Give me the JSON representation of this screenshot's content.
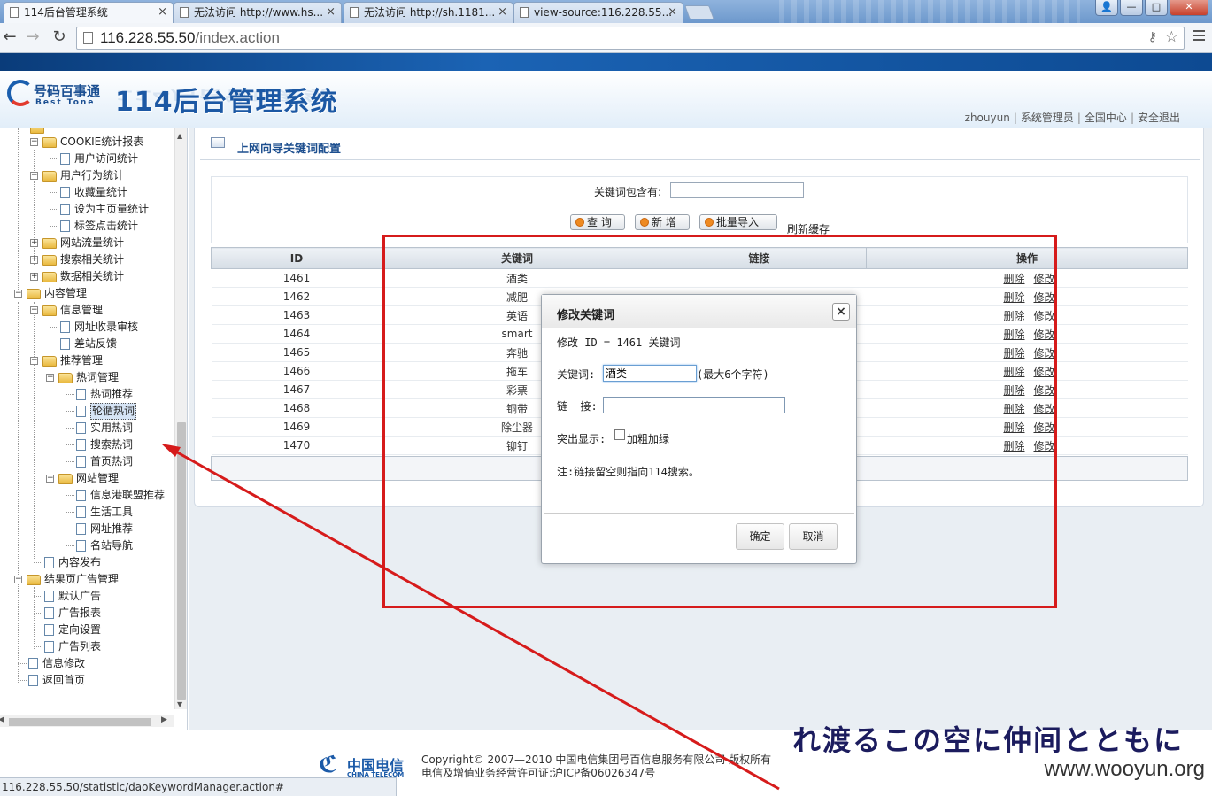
{
  "browser": {
    "tabs": [
      {
        "label": "114后台管理系统",
        "close": "×"
      },
      {
        "label": "无法访问 http://www.hs...",
        "close": "×"
      },
      {
        "label": "无法访问 http://sh.1181...",
        "close": "×"
      },
      {
        "label": "view-source:116.228.55...",
        "close": "×"
      }
    ],
    "window_buttons": {
      "minimize": "—",
      "maximize": "□",
      "close": "✕",
      "user": "👤"
    },
    "nav": {
      "back": "←",
      "forward": "→",
      "reload": "↻"
    },
    "url_host": "116.228.55.50",
    "url_path": "/index.action",
    "status_url": "116.228.55.50/statistic/daoKeywordManager.action#"
  },
  "header": {
    "logo_cn": "号码百事通",
    "logo_en": "Best Tone",
    "title": "114后台管理系统",
    "user_links": [
      "zhouyun",
      "系统管理员",
      "全国中心",
      "安全退出"
    ]
  },
  "sidebar": {
    "items": [
      {
        "label": "COOKIE统计报表",
        "type": "folder"
      },
      {
        "label": "用户访问统计",
        "type": "doc"
      },
      {
        "label": "用户行为统计",
        "type": "folder"
      },
      {
        "label": "收藏量统计",
        "type": "doc"
      },
      {
        "label": "设为主页量统计",
        "type": "doc"
      },
      {
        "label": "标签点击统计",
        "type": "doc"
      },
      {
        "label": "网站流量统计",
        "type": "folder"
      },
      {
        "label": "搜索相关统计",
        "type": "folder"
      },
      {
        "label": "数据相关统计",
        "type": "folder"
      },
      {
        "label": "内容管理",
        "type": "folder"
      },
      {
        "label": "信息管理",
        "type": "folder"
      },
      {
        "label": "网址收录审核",
        "type": "doc"
      },
      {
        "label": "差站反馈",
        "type": "doc"
      },
      {
        "label": "推荐管理",
        "type": "folder"
      },
      {
        "label": "热词管理",
        "type": "folder"
      },
      {
        "label": "热词推荐",
        "type": "doc"
      },
      {
        "label": "轮循热词",
        "type": "doc"
      },
      {
        "label": "实用热词",
        "type": "doc"
      },
      {
        "label": "搜索热词",
        "type": "doc"
      },
      {
        "label": "首页热词",
        "type": "doc"
      },
      {
        "label": "网站管理",
        "type": "folder"
      },
      {
        "label": "信息港联盟推荐",
        "type": "doc"
      },
      {
        "label": "生活工具",
        "type": "doc"
      },
      {
        "label": "网址推荐",
        "type": "doc"
      },
      {
        "label": "名站导航",
        "type": "doc"
      },
      {
        "label": "内容发布",
        "type": "doc"
      },
      {
        "label": "结果页广告管理",
        "type": "folder"
      },
      {
        "label": "默认广告",
        "type": "doc"
      },
      {
        "label": "广告报表",
        "type": "doc"
      },
      {
        "label": "定向设置",
        "type": "doc"
      },
      {
        "label": "广告列表",
        "type": "doc"
      },
      {
        "label": "信息修改",
        "type": "doc"
      },
      {
        "label": "返回首页",
        "type": "doc"
      }
    ]
  },
  "page": {
    "title": "上网向导关键词配置",
    "search_label": "关键词包含有:",
    "search_value": "",
    "buttons": {
      "query": "查 询",
      "add": "新 增",
      "import": "批量导入"
    },
    "refresh_link": "刷新缓存"
  },
  "table": {
    "columns": [
      "ID",
      "关键词",
      "链接",
      "操作"
    ],
    "rows": [
      {
        "id": "1461",
        "keyword": "酒类",
        "link": ""
      },
      {
        "id": "1462",
        "keyword": "减肥",
        "link": ""
      },
      {
        "id": "1463",
        "keyword": "英语",
        "link": ""
      },
      {
        "id": "1464",
        "keyword": "smart",
        "link": ""
      },
      {
        "id": "1465",
        "keyword": "奔驰",
        "link": ""
      },
      {
        "id": "1466",
        "keyword": "拖车",
        "link": ""
      },
      {
        "id": "1467",
        "keyword": "彩票",
        "link": ""
      },
      {
        "id": "1468",
        "keyword": "铜带",
        "link": ""
      },
      {
        "id": "1469",
        "keyword": "除尘器",
        "link": ""
      },
      {
        "id": "1470",
        "keyword": "铆钉",
        "link": ""
      }
    ],
    "ops": {
      "delete": "删除",
      "edit": "修改"
    }
  },
  "modal": {
    "title": "修改关键词",
    "close": "×",
    "subtitle": "修改 ID = 1461 关键词",
    "keyword_label": "关键词:",
    "keyword_value": "酒类",
    "keyword_hint": "(最大6个字符)",
    "link_label": "链  接:",
    "link_value": "",
    "highlight_label": "突出显示:",
    "highlight_option": "加粗加绿",
    "note": "注:链接留空则指向114搜索。",
    "confirm": "确定",
    "cancel": "取消"
  },
  "footer": {
    "ct_cn": "中国电信",
    "ct_en": "CHINA TELECOM",
    "copyright_line1": "Copyright© 2007—2010 中国电信集团号百信息服务有限公司 版权所有",
    "copyright_line2": "电信及增值业务经营许可证:沪ICP备06026347号",
    "overlay_caption": "れ渡るこの空に仲间とともに",
    "watermark": "www.wooyun.org"
  },
  "colors": {
    "highlight_red": "#d61b1b",
    "header_blue": "#1c58a4"
  }
}
